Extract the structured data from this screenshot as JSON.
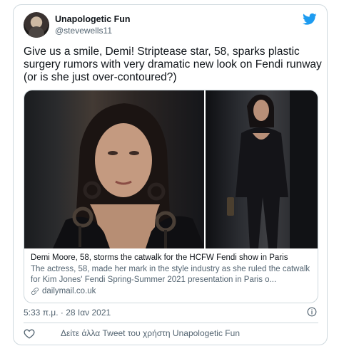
{
  "user": {
    "name": "Unapologetic Fun",
    "handle": "@stevewells11"
  },
  "tweet": {
    "text": "Give us a smile, Demi! Striptease star, 58, sparks plastic surgery rumors with very dramatic new look on Fendi runway (or is she just over-contoured?)",
    "timestamp": "5:33 π.μ. · 28 Ιαν 2021"
  },
  "card": {
    "title": "Demi Moore, 58, storms the catwalk for the HCFW Fendi show in Paris",
    "description": "The actress, 58, made her mark in the style industry as she ruled the catwalk for Kim Jones' Fendi Spring-Summer 2021 presentation in Paris o...",
    "domain": "dailymail.co.uk"
  },
  "footer": {
    "more_tweets": "Δείτε άλλα Tweet του χρήστη Unapologetic Fun"
  },
  "colors": {
    "twitter_blue": "#1d9bf0",
    "secondary_text": "#536471",
    "border": "#cfd9de"
  },
  "icons": [
    "twitter-bird-icon",
    "link-icon",
    "info-icon",
    "heart-icon"
  ]
}
